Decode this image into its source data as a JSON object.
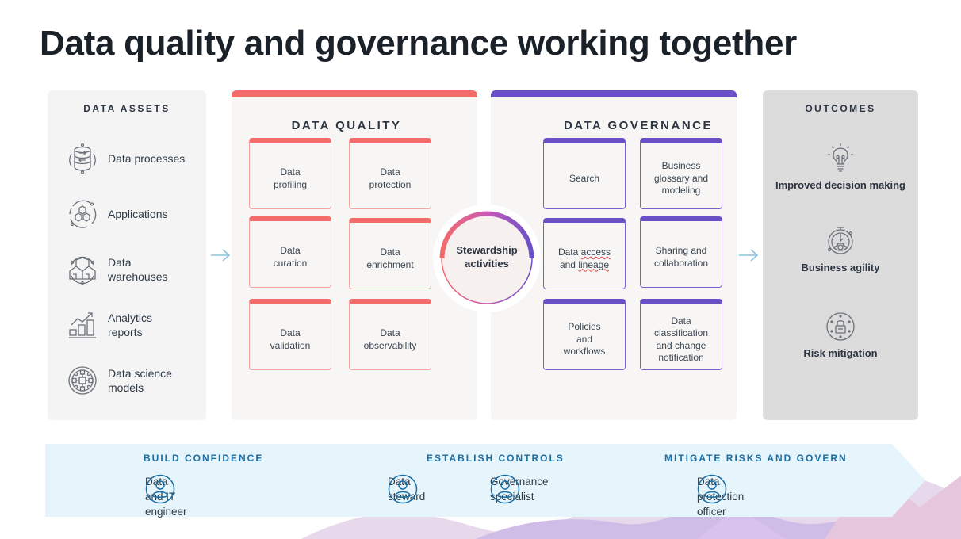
{
  "title": "Data quality and governance working together",
  "colors": {
    "quality_accent": "#f36b6b",
    "governance_accent": "#6a4fc7",
    "arrow": "#8cc3e0",
    "band_heading": "#1b6fa3",
    "band_bg": "#e6f4fb"
  },
  "data_assets": {
    "heading": "DATA ASSETS",
    "items": [
      {
        "icon": "database-process-icon",
        "label_line1": "Data processes",
        "label_line2": ""
      },
      {
        "icon": "applications-hexagons-icon",
        "label_line1": "Applications",
        "label_line2": ""
      },
      {
        "icon": "data-warehouse-icon",
        "label_line1": "Data",
        "label_line2": "warehouses"
      },
      {
        "icon": "analytics-chart-icon",
        "label_line1": "Analytics",
        "label_line2": "reports"
      },
      {
        "icon": "data-science-network-icon",
        "label_line1": "Data science",
        "label_line2": "models"
      }
    ]
  },
  "data_quality": {
    "heading": "DATA QUALITY",
    "cards": [
      {
        "line1": "Data",
        "line2": "profiling",
        "line3": ""
      },
      {
        "line1": "Data",
        "line2": "protection",
        "line3": ""
      },
      {
        "line1": "Data",
        "line2": "curation",
        "line3": ""
      },
      {
        "line1": "Data",
        "line2": "enrichment",
        "line3": ""
      },
      {
        "line1": "Data",
        "line2": "validation",
        "line3": ""
      },
      {
        "line1": "Data",
        "line2": "observability",
        "line3": ""
      }
    ]
  },
  "stewardship": {
    "line1": "Stewardship",
    "line2": "activities"
  },
  "data_governance": {
    "heading": "DATA GOVERNANCE",
    "cards": [
      {
        "line1": "Search",
        "line2": "",
        "line3": ""
      },
      {
        "line1": "Business",
        "line2": "glossary and",
        "line3": "modeling"
      },
      {
        "line1": "Data access",
        "line2": "and lineage",
        "line3": ""
      },
      {
        "line1": "Sharing and",
        "line2": "collaboration",
        "line3": ""
      },
      {
        "line1": "Policies",
        "line2": "and",
        "line3": "workflows"
      },
      {
        "line1": "Data classification",
        "line2": "and change",
        "line3": "notification"
      }
    ]
  },
  "outcomes": {
    "heading": "OUTCOMES",
    "items": [
      {
        "icon": "lightbulb-icon",
        "label": "Improved decision making"
      },
      {
        "icon": "stopwatch-gear-icon",
        "label": "Business agility"
      },
      {
        "icon": "lock-stars-icon",
        "label": "Risk mitigation"
      }
    ]
  },
  "roles_band": {
    "sections": [
      {
        "heading": "BUILD CONFIDENCE",
        "people": [
          {
            "line1": "Data and IT",
            "line2": "engineer"
          }
        ]
      },
      {
        "heading": "ESTABLISH CONTROLS",
        "people": [
          {
            "line1": "Data",
            "line2": "steward"
          },
          {
            "line1": "Governance",
            "line2": "specialist"
          }
        ]
      },
      {
        "heading": "MITIGATE RISKS AND GOVERN",
        "people": [
          {
            "line1": "Data protection",
            "line2": "officer"
          }
        ]
      }
    ]
  }
}
